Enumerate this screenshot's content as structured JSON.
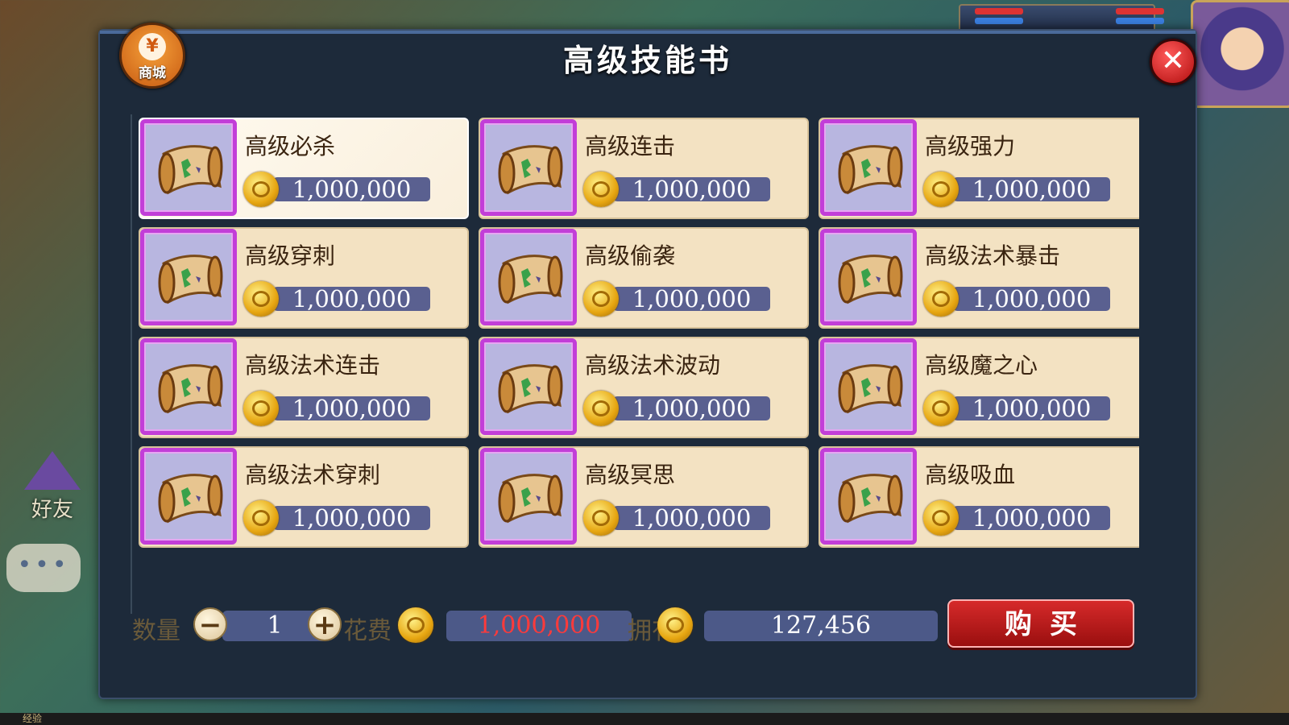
{
  "dialog": {
    "title": "高级技能书",
    "shop_badge": {
      "icon_glyph": "¥",
      "label": "商城"
    },
    "close_glyph": "✕"
  },
  "items": [
    {
      "name": "高级必杀",
      "price": "1,000,000",
      "selected": true
    },
    {
      "name": "高级连击",
      "price": "1,000,000"
    },
    {
      "name": "高级强力",
      "price": "1,000,000"
    },
    {
      "name": "高级穿刺",
      "price": "1,000,000"
    },
    {
      "name": "高级偷袭",
      "price": "1,000,000"
    },
    {
      "name": "高级法术暴击",
      "price": "1,000,000"
    },
    {
      "name": "高级法术连击",
      "price": "1,000,000"
    },
    {
      "name": "高级法术波动",
      "price": "1,000,000"
    },
    {
      "name": "高级魔之心",
      "price": "1,000,000"
    },
    {
      "name": "高级法术穿刺",
      "price": "1,000,000"
    },
    {
      "name": "高级冥思",
      "price": "1,000,000"
    },
    {
      "name": "高级吸血",
      "price": "1,000,000"
    }
  ],
  "footer": {
    "quantity_label": "数量",
    "quantity_value": "1",
    "minus_glyph": "−",
    "plus_glyph": "+",
    "cost_label": "花费",
    "cost_value": "1,000,000",
    "own_label": "拥有",
    "own_value": "127,456",
    "buy_label": "购买"
  },
  "background": {
    "friend_label": "好友",
    "chat_glyph": "•••",
    "exp_label": "经验"
  },
  "colors": {
    "dialog_bg": "#1d2a3a",
    "card_bg": "#f3e2c2",
    "icon_frame": "#c23ed8",
    "price_bar": "#5a6090",
    "cost_text": "#ff3a3a",
    "buy_button": "#c21d1d"
  },
  "icons": {
    "item_icon": "skill-book-scroll-icon",
    "currency_icon": "gold-coin-icon"
  }
}
